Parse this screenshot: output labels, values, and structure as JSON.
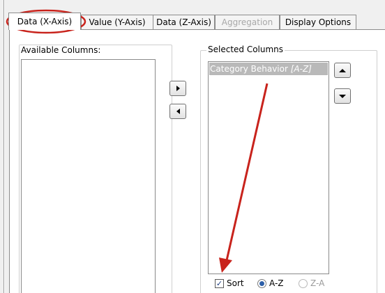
{
  "tabs": [
    {
      "label": "Data (X-Axis)",
      "active": true,
      "enabled": true
    },
    {
      "label": "Value (Y-Axis)",
      "active": false,
      "enabled": true
    },
    {
      "label": "Data (Z-Axis)",
      "active": false,
      "enabled": true
    },
    {
      "label": "Aggregation",
      "active": false,
      "enabled": false
    },
    {
      "label": "Display Options",
      "active": false,
      "enabled": true
    }
  ],
  "available": {
    "title": "Available Columns:",
    "items": []
  },
  "transfer": {
    "add_icon": "arrow-right-icon",
    "remove_icon": "arrow-left-icon"
  },
  "selected": {
    "title": "Selected Columns",
    "items": [
      {
        "name": "Category Behavior",
        "hint": "[A-Z]"
      }
    ],
    "move_up_icon": "arrow-up-icon",
    "move_down_icon": "arrow-down-icon"
  },
  "sort": {
    "label": "Sort",
    "checked": true,
    "options": [
      {
        "label": "A-Z",
        "selected": true,
        "enabled": true
      },
      {
        "label": "Z-A",
        "selected": false,
        "enabled": false
      }
    ]
  },
  "annotations": {
    "color": "#c8231c"
  }
}
